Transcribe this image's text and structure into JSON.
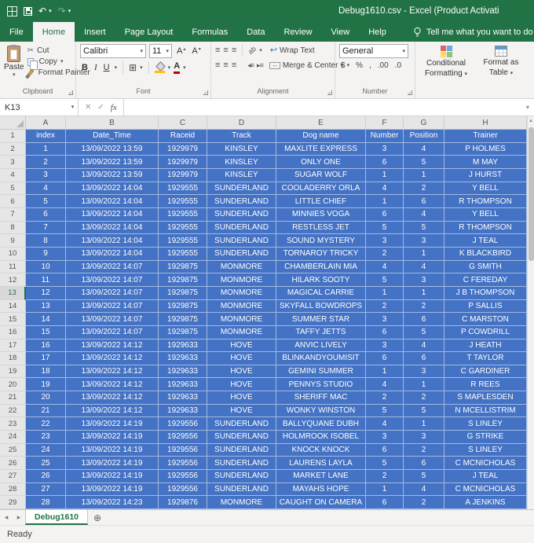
{
  "title_bar": {
    "title": "Debug1610.csv - Excel (Product Activati"
  },
  "ribbon": {
    "tabs": [
      "File",
      "Home",
      "Insert",
      "Page Layout",
      "Formulas",
      "Data",
      "Review",
      "View",
      "Help"
    ],
    "active_tab": "Home",
    "tell_me": "Tell me what you want to do",
    "clipboard": {
      "label": "Clipboard",
      "paste": "Paste",
      "cut": "Cut",
      "copy": "Copy",
      "format_painter": "Format Painter"
    },
    "font": {
      "label": "Font",
      "family": "Calibri",
      "size": "11",
      "bold": "B",
      "italic": "I",
      "underline": "U"
    },
    "alignment": {
      "label": "Alignment",
      "wrap_text": "Wrap Text",
      "merge_center": "Merge & Center"
    },
    "number": {
      "label": "Number",
      "format": "General",
      "currency": "$",
      "percent": "%",
      "comma": ",",
      "dec_inc": ".00",
      "dec_dec": ".0"
    },
    "styles": {
      "conditional_line1": "Conditional",
      "conditional_line2": "Formatting",
      "table_line1": "Format as",
      "table_line2": "Table"
    }
  },
  "formula_bar": {
    "name_box": "K13",
    "fx": "fx"
  },
  "grid": {
    "columns": [
      "A",
      "B",
      "C",
      "D",
      "E",
      "F",
      "G",
      "H"
    ],
    "headers": [
      "index",
      "Date_Time",
      "Raceid",
      "Track",
      "Dog name",
      "Number",
      "Position",
      "Trainer"
    ],
    "active_row": 13,
    "rows": [
      [
        "1",
        "13/09/2022 13:59",
        "1929979",
        "KINSLEY",
        "MAXLITE EXPRESS",
        "3",
        "4",
        "P HOLMES"
      ],
      [
        "2",
        "13/09/2022 13:59",
        "1929979",
        "KINSLEY",
        "ONLY ONE",
        "6",
        "5",
        "M MAY"
      ],
      [
        "3",
        "13/09/2022 13:59",
        "1929979",
        "KINSLEY",
        "SUGAR WOLF",
        "1",
        "1",
        "J HURST"
      ],
      [
        "4",
        "13/09/2022 14:04",
        "1929555",
        "SUNDERLAND",
        "COOLADERRY ORLA",
        "4",
        "2",
        "Y BELL"
      ],
      [
        "5",
        "13/09/2022 14:04",
        "1929555",
        "SUNDERLAND",
        "LITTLE CHIEF",
        "1",
        "6",
        "R THOMPSON"
      ],
      [
        "6",
        "13/09/2022 14:04",
        "1929555",
        "SUNDERLAND",
        "MINNIES VOGA",
        "6",
        "4",
        "Y BELL"
      ],
      [
        "7",
        "13/09/2022 14:04",
        "1929555",
        "SUNDERLAND",
        "RESTLESS JET",
        "5",
        "5",
        "R THOMPSON"
      ],
      [
        "8",
        "13/09/2022 14:04",
        "1929555",
        "SUNDERLAND",
        "SOUND MYSTERY",
        "3",
        "3",
        "J TEAL"
      ],
      [
        "9",
        "13/09/2022 14:04",
        "1929555",
        "SUNDERLAND",
        "TORNAROY TRICKY",
        "2",
        "1",
        "K BLACKBIRD"
      ],
      [
        "10",
        "13/09/2022 14:07",
        "1929875",
        "MONMORE",
        "CHAMBERLAIN MIA",
        "4",
        "4",
        "G SMITH"
      ],
      [
        "11",
        "13/09/2022 14:07",
        "1929875",
        "MONMORE",
        "HILARK SOOTY",
        "5",
        "3",
        "C FEREDAY"
      ],
      [
        "12",
        "13/09/2022 14:07",
        "1929875",
        "MONMORE",
        "MAGICAL CARRIE",
        "1",
        "1",
        "J B THOMPSON"
      ],
      [
        "13",
        "13/09/2022 14:07",
        "1929875",
        "MONMORE",
        "SKYFALL BOWDROPS",
        "2",
        "2",
        "P SALLIS"
      ],
      [
        "14",
        "13/09/2022 14:07",
        "1929875",
        "MONMORE",
        "SUMMER STAR",
        "3",
        "6",
        "C MARSTON"
      ],
      [
        "15",
        "13/09/2022 14:07",
        "1929875",
        "MONMORE",
        "TAFFY JETTS",
        "6",
        "5",
        "P COWDRILL"
      ],
      [
        "16",
        "13/09/2022 14:12",
        "1929633",
        "HOVE",
        "ANVIC LIVELY",
        "3",
        "4",
        "J HEATH"
      ],
      [
        "17",
        "13/09/2022 14:12",
        "1929633",
        "HOVE",
        "BLINKANDYOUMISIT",
        "6",
        "6",
        "T TAYLOR"
      ],
      [
        "18",
        "13/09/2022 14:12",
        "1929633",
        "HOVE",
        "GEMINI SUMMER",
        "1",
        "3",
        "C GARDINER"
      ],
      [
        "19",
        "13/09/2022 14:12",
        "1929633",
        "HOVE",
        "PENNYS STUDIO",
        "4",
        "1",
        "R REES"
      ],
      [
        "20",
        "13/09/2022 14:12",
        "1929633",
        "HOVE",
        "SHERIFF MAC",
        "2",
        "2",
        "S MAPLESDEN"
      ],
      [
        "21",
        "13/09/2022 14:12",
        "1929633",
        "HOVE",
        "WONKY WINSTON",
        "5",
        "5",
        "N MCELLISTRIM"
      ],
      [
        "22",
        "13/09/2022 14:19",
        "1929556",
        "SUNDERLAND",
        "BALLYQUANE DUBH",
        "4",
        "1",
        "S LINLEY"
      ],
      [
        "23",
        "13/09/2022 14:19",
        "1929556",
        "SUNDERLAND",
        "HOLMROOK ISOBEL",
        "3",
        "3",
        "G STRIKE"
      ],
      [
        "24",
        "13/09/2022 14:19",
        "1929556",
        "SUNDERLAND",
        "KNOCK KNOCK",
        "6",
        "2",
        "S LINLEY"
      ],
      [
        "25",
        "13/09/2022 14:19",
        "1929556",
        "SUNDERLAND",
        "LAURENS LAYLA",
        "5",
        "6",
        "C MCNICHOLAS"
      ],
      [
        "26",
        "13/09/2022 14:19",
        "1929556",
        "SUNDERLAND",
        "MARKET LANE",
        "2",
        "5",
        "J TEAL"
      ],
      [
        "27",
        "13/09/2022 14:19",
        "1929556",
        "SUNDERLAND",
        "MAYAHS HOPE",
        "1",
        "4",
        "C MCNICHOLAS"
      ],
      [
        "28",
        "13/09/2022 14:23",
        "1929876",
        "MONMORE",
        "CAUGHT ON CAMERA",
        "6",
        "2",
        "A JENKINS"
      ]
    ]
  },
  "sheet_bar": {
    "tab": "Debug1610"
  },
  "status_bar": {
    "status": "Ready"
  },
  "icons": {
    "dropdown": "▾",
    "undo": "↶",
    "redo": "↷",
    "qat_more": "▾",
    "cut": "✂",
    "grow_font": "A",
    "grow_arrow": "▴",
    "shrink_font": "A",
    "shrink_arrow": "▾",
    "borders": "⊞",
    "align_lines": "≡",
    "orientation": "ab",
    "indent_left": "◂≡",
    "indent_right": "▸≡",
    "wrap_arrow": "↩",
    "merge_arrow": "↔",
    "cancel": "✕",
    "confirm": "✓",
    "add_sheet": "⊕",
    "nav_left": "◂",
    "nav_right": "▸",
    "scroll_up": "▲",
    "expand_formula": "▾"
  },
  "colors": {
    "excel_green": "#217346",
    "cell_fill": "#4472c4",
    "cell_text": "#ffffff",
    "fill_accent": "#ffc000",
    "font_color_accent": "#c00000"
  }
}
